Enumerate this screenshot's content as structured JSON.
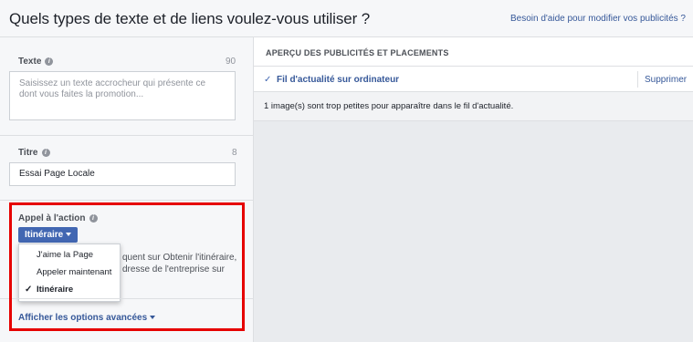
{
  "header": {
    "title": "Quels types de texte et de liens voulez-vous utiliser ?",
    "help_link": "Besoin d'aide pour modifier vos publicités ?"
  },
  "text_field": {
    "label": "Texte",
    "counter": "90",
    "placeholder": "Saisissez un texte accrocheur qui présente ce dont vous faites la promotion..."
  },
  "title_field": {
    "label": "Titre",
    "counter": "8",
    "value": "Essai Page Locale"
  },
  "call_to_action": {
    "label": "Appel à l'action",
    "selected": "Itinéraire",
    "description_line1": "quent sur Obtenir l'itinéraire,",
    "description_line2": "dresse de l'entreprise sur",
    "options": [
      {
        "label": "J'aime la Page",
        "checked": false
      },
      {
        "label": "Appeler maintenant",
        "checked": false
      },
      {
        "label": "Itinéraire",
        "checked": true
      }
    ]
  },
  "advanced_link": "Afficher les options avancées",
  "preview": {
    "title": "APERÇU DES PUBLICITÉS ET PLACEMENTS",
    "placement": "Fil d'actualité sur ordinateur",
    "remove_label": "Supprimer",
    "warning": "1 image(s) sont trop petites pour apparaître dans le fil d'actualité."
  },
  "colors": {
    "accent": "#4267b2",
    "link": "#365899",
    "highlight": "#e60000"
  }
}
